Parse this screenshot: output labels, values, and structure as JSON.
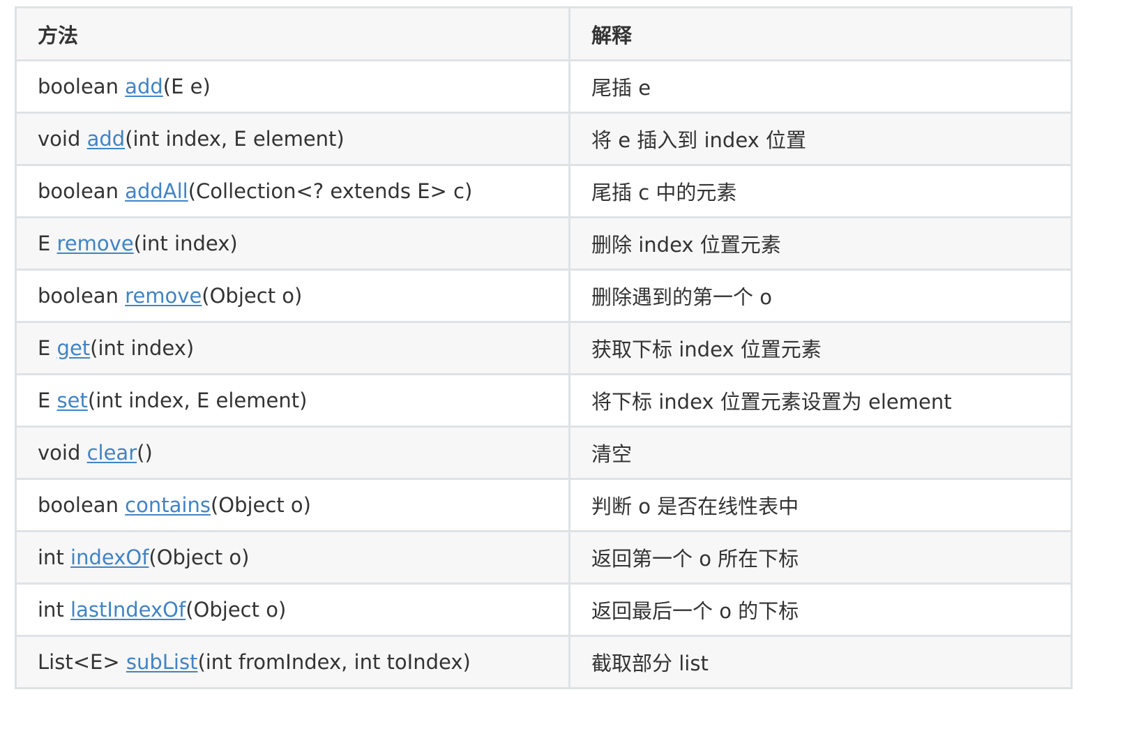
{
  "table": {
    "headers": {
      "method": "方法",
      "explanation": "解释"
    },
    "rows": [
      {
        "prefix": "boolean ",
        "link": "add",
        "suffix": "(E e)",
        "desc": "尾插 e"
      },
      {
        "prefix": "void ",
        "link": "add",
        "suffix": "(int index, E element)",
        "desc": "将 e 插入到 index 位置"
      },
      {
        "prefix": "boolean ",
        "link": "addAll",
        "suffix": "(Collection<? extends E> c)",
        "desc": "尾插 c 中的元素"
      },
      {
        "prefix": "E ",
        "link": "remove",
        "suffix": "(int index)",
        "desc": "删除 index 位置元素"
      },
      {
        "prefix": "boolean ",
        "link": "remove",
        "suffix": "(Object o)",
        "desc": "删除遇到的第一个 o"
      },
      {
        "prefix": "E ",
        "link": "get",
        "suffix": "(int index)",
        "desc": "获取下标 index 位置元素"
      },
      {
        "prefix": "E ",
        "link": "set",
        "suffix": "(int index, E element)",
        "desc": "将下标 index 位置元素设置为 element"
      },
      {
        "prefix": "void ",
        "link": "clear",
        "suffix": "()",
        "desc": "清空"
      },
      {
        "prefix": "boolean ",
        "link": "contains",
        "suffix": "(Object o)",
        "desc": "判断 o 是否在线性表中"
      },
      {
        "prefix": "int ",
        "link": "indexOf",
        "suffix": "(Object o)",
        "desc": "返回第一个 o 所在下标"
      },
      {
        "prefix": "int ",
        "link": "lastIndexOf",
        "suffix": "(Object o)",
        "desc": "返回最后一个 o 的下标"
      },
      {
        "prefix": "List<E> ",
        "link": "subList",
        "suffix": "(int fromIndex, int toIndex)",
        "desc": "截取部分 list"
      }
    ]
  },
  "colors": {
    "link": "#4183c4",
    "border": "#dfe2e5",
    "stripe": "#f7f7f7",
    "text": "#333333"
  }
}
